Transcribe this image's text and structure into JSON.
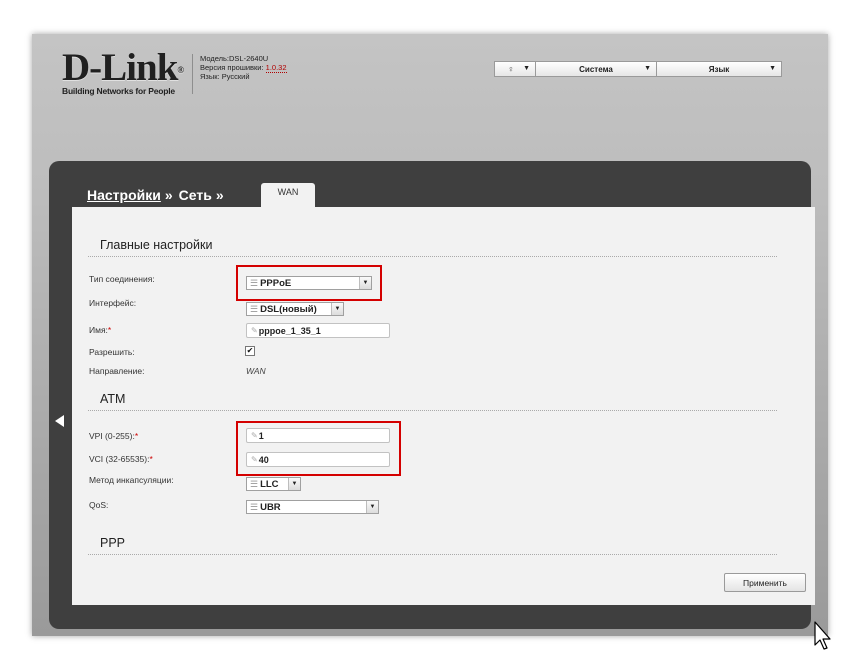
{
  "header": {
    "logo_text": "D-Link",
    "logo_registered": "®",
    "logo_tagline": "Building Networks for People",
    "model_line": "Модель:DSL-2640U",
    "firmware_label": "Версия прошивки:",
    "firmware_version": "1.0.32",
    "language_line": "Язык: Русский"
  },
  "topbar": {
    "help_icon": "lightbulb-icon",
    "system_label": "Система",
    "language_label": "Язык"
  },
  "breadcrumb": {
    "settings": "Настройки",
    "network": "Сеть",
    "separator": "»",
    "tab": "WAN"
  },
  "main_settings": {
    "title": "Главные настройки",
    "connection_type_label": "Тип соединения:",
    "connection_type_value": "PPPoE",
    "interface_label": "Интерфейс:",
    "interface_value": "DSL(новый)",
    "name_label": "Имя:",
    "name_value": "pppoe_1_35_1",
    "enable_label": "Разрешить:",
    "enable_checked": true,
    "direction_label": "Направление:",
    "direction_value": "WAN"
  },
  "atm": {
    "title": "ATM",
    "vpi_label": "VPI (0-255):",
    "vpi_value": "1",
    "vci_label": "VCI (32-65535):",
    "vci_value": "40",
    "encap_label": "Метод инкапсуляции:",
    "encap_value": "LLC",
    "qos_label": "QoS:",
    "qos_value": "UBR"
  },
  "ppp": {
    "title": "PPP"
  },
  "required_mark": "*",
  "check_mark": "✔",
  "apply_label": "Применить",
  "colors": {
    "highlight": "#d40000",
    "panel": "#3f3f3f",
    "content": "#f2f2f2"
  }
}
